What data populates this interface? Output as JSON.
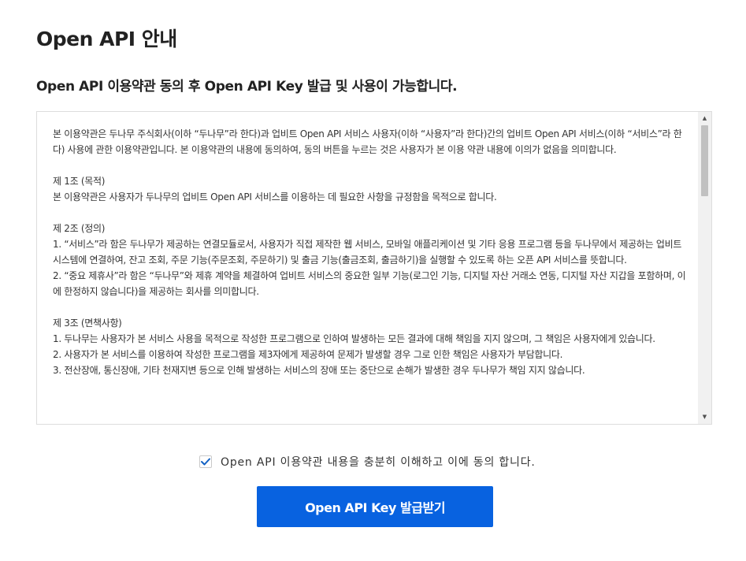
{
  "page": {
    "title": "Open API 안내",
    "subtitle": "Open API 이용약관 동의 후 Open API Key 발급 및 사용이 가능합니다."
  },
  "terms": {
    "intro": "본 이용약관은 두나무 주식회사(이하 “두나무”라 한다)과 업비트 Open API 서비스 사용자(이하 “사용자”라 한다)간의 업비트 Open API 서비스(이하 “서비스”라 한다) 사용에 관한 이용약관입니다. 본 이용약관의 내용에 동의하여, 동의 버튼을 누르는 것은 사용자가 본 이용 약관 내용에 이의가 없음을 의미합니다.",
    "sections": [
      {
        "heading": "제 1조 (목적)",
        "paragraphs": [
          "본 이용약관은 사용자가 두나무의 업비트 Open API 서비스를 이용하는 데 필요한 사항을 규정함을 목적으로 합니다."
        ]
      },
      {
        "heading": "제 2조 (정의)",
        "paragraphs": [
          "1. “서비스”라 함은 두나무가 제공하는 연결모듈로서, 사용자가 직접 제작한 웹 서비스, 모바일 애플리케이션 및 기타 응용 프로그램 등을 두나무에서 제공하는 업비트 시스템에 연결하여, 잔고 조회, 주문 기능(주문조회, 주문하기) 및 출금 기능(출금조회, 출금하기)을 실행할 수 있도록 하는 오픈 API 서비스를 뜻합니다.",
          "2. “중요 제휴사”라 함은 “두나무”와 제휴 계약을 체결하여 업비트 서비스의 중요한 일부 기능(로그인 기능, 디지털 자산 거래소 연동, 디지털 자산 지갑을 포함하며, 이에 한정하지 않습니다)을 제공하는 회사를 의미합니다."
        ]
      },
      {
        "heading": "제 3조 (면책사항)",
        "paragraphs": [
          "1. 두나무는 사용자가 본 서비스 사용을 목적으로 작성한 프로그램으로 인하여 발생하는 모든 결과에 대해 책임을 지지 않으며, 그 책임은 사용자에게 있습니다.",
          "2. 사용자가 본 서비스를 이용하여 작성한 프로그램을 제3자에게 제공하여 문제가 발생할 경우 그로 인한 책임은 사용자가 부담합니다.",
          "3. 전산장애, 통신장애, 기타 천재지변 등으로 인해 발생하는 서비스의 장애 또는 중단으로 손해가 발생한 경우 두나무가 책임 지지 않습니다."
        ]
      }
    ]
  },
  "agreement": {
    "checked": true,
    "label": "Open API 이용약관 내용을 충분히 이해하고 이에 동의 합니다."
  },
  "actions": {
    "issue_key_label": "Open API Key 발급받기"
  },
  "colors": {
    "primary": "#0862e0",
    "check": "#1261c4",
    "border": "#dddddd",
    "text": "#333333"
  },
  "icons": {
    "checkbox": "check-icon",
    "scroll_up": "scroll-up-arrow-icon",
    "scroll_down": "scroll-down-arrow-icon"
  }
}
